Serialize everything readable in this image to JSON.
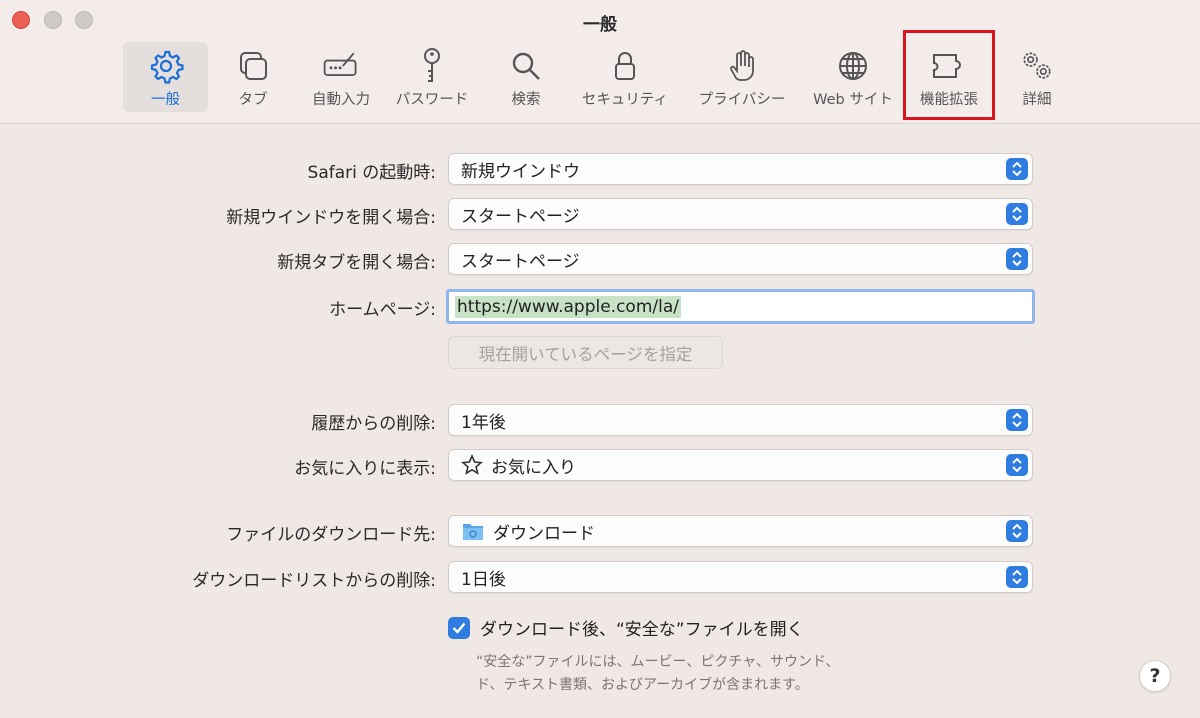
{
  "window": {
    "title": "一般"
  },
  "tabs": [
    {
      "label": "一般",
      "icon": "gear-icon",
      "active": true
    },
    {
      "label": "タブ",
      "icon": "tabs-icon"
    },
    {
      "label": "自動入力",
      "icon": "autofill-icon"
    },
    {
      "label": "パスワード",
      "icon": "key-icon"
    },
    {
      "label": "検索",
      "icon": "search-icon"
    },
    {
      "label": "セキュリティ",
      "icon": "lock-icon"
    },
    {
      "label": "プライバシー",
      "icon": "hand-icon"
    },
    {
      "label": "Web サイト",
      "icon": "globe-icon"
    },
    {
      "label": "機能拡張",
      "icon": "puzzle-icon"
    },
    {
      "label": "詳細",
      "icon": "gears-icon"
    }
  ],
  "form": {
    "launch_label": "Safari の起動時:",
    "launch_value": "新規ウインドウ",
    "new_window_label": "新規ウインドウを開く場合:",
    "new_window_value": "スタートページ",
    "new_tab_label": "新規タブを開く場合:",
    "new_tab_value": "スタートページ",
    "homepage_label": "ホームページ:",
    "homepage_value": "https://www.apple.com/la/",
    "set_current_label": "現在開いているページを指定",
    "history_label": "履歴からの削除:",
    "history_value": "1年後",
    "favorites_label": "お気に入りに表示:",
    "favorites_value": "お気に入り",
    "download_location_label": "ファイルのダウンロード先:",
    "download_location_value": "ダウンロード",
    "download_list_label": "ダウンロードリストからの削除:",
    "download_list_value": "1日後",
    "open_safe_label": "ダウンロード後、“安全な”ファイルを開く",
    "open_safe_checked": true,
    "note_line1": "“安全な”ファイルには、ムービー、ピクチャ、サウンド、",
    "note_line2": "ド、テキスト書類、およびアーカイブが含まれます。"
  },
  "help": {
    "label": "?"
  },
  "colors": {
    "accent": "#2f7de1",
    "highlight": "#d8141c",
    "active_tab_text": "#1a6fd8"
  }
}
